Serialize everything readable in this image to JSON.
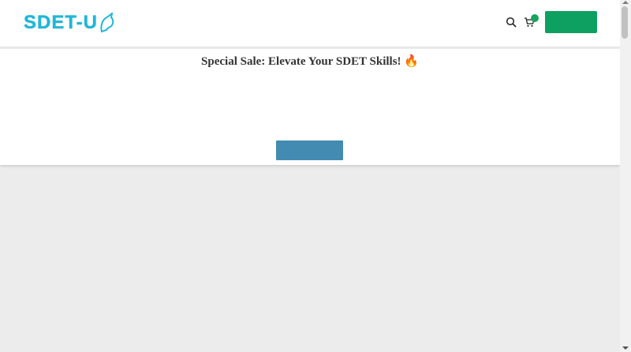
{
  "header": {
    "logo_text": "SDET-U",
    "search_icon": "search-icon",
    "cart_icon": "cart-icon",
    "cart_badge_color": "#18a35d",
    "cta_color": "#0ea060"
  },
  "promo": {
    "title": "Special Sale: Elevate Your SDET Skills! 🔥",
    "button_color": "#438bb0"
  }
}
